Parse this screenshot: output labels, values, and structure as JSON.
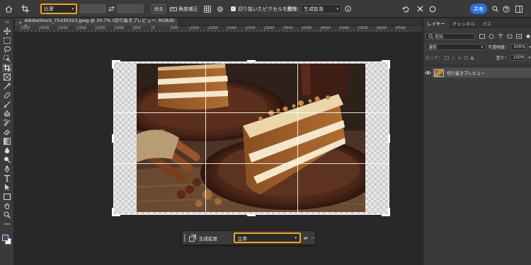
{
  "options_bar": {
    "ratio_label": "比率",
    "clear_label": "消去",
    "straighten_label": "角度補正",
    "delete_pixels_label": "切り抜いたピクセルを削除",
    "fill_label": "塗り：",
    "fill_value": "生成拡張",
    "share_label": "共有"
  },
  "document": {
    "tab_title": "AdobeStock_75430323.jpeg @ 20.7% (切り抜きプレビュー, RGB/8) *",
    "close_glyph": "×"
  },
  "ruler": {
    "labels": [
      "3500",
      "3000",
      "2500",
      "2000",
      "1500",
      "1000",
      "500",
      "0",
      "500",
      "1000",
      "1500",
      "2000",
      "2500",
      "3000",
      "3500",
      "4000",
      "4500",
      "5000",
      "5500",
      "6000",
      "6500"
    ]
  },
  "taskbar": {
    "generate_label": "生成拡張",
    "ratio_value": "比率",
    "swap_label": "⇄",
    "more_label": "···"
  },
  "panel": {
    "tabs": [
      "レイヤー",
      "チャンネル",
      "パス"
    ],
    "search_placeholder": "種類",
    "blend_mode": "通常",
    "opacity_label": "不透明度：",
    "opacity_value": "100%",
    "lock_label": "ロック：",
    "fill_label": "塗り：",
    "fill_value": "100%",
    "layer_name": "切り抜きプレビュー"
  },
  "colors": {
    "accent_orange": "#f4a11a",
    "share_blue": "#2b6fde",
    "app_bg": "#2b2b2b"
  }
}
